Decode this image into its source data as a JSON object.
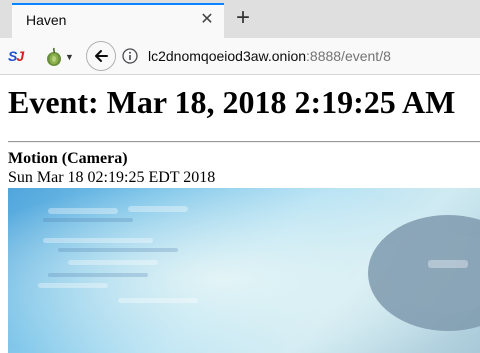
{
  "browser": {
    "tab": {
      "title": "Haven",
      "close_glyph": "✕"
    },
    "new_tab_glyph": "+",
    "toolbar": {
      "extension_1_icon": "sj-extension-icon",
      "extension_1_text_a": "S",
      "extension_1_text_b": "J",
      "extension_2_icon": "tor-onion-icon",
      "back_icon": "back-arrow-icon",
      "info_icon": "info-icon"
    },
    "url": {
      "host": "lc2dnomqoeiod3aw.onion",
      "rest": ":8888/event/8"
    }
  },
  "page": {
    "heading": "Event: Mar 18, 2018 2:19:25 AM",
    "event_type": "Motion (Camera)",
    "event_time": "Sun Mar 18 02:19:25 EDT 2018",
    "image_icon": "camera-capture-image"
  },
  "colors": {
    "tab_accent": "#0a84ff",
    "tab_strip_bg": "#dfdfe0",
    "toolbar_bg": "#f9f9fa",
    "url_dim": "#737373"
  }
}
